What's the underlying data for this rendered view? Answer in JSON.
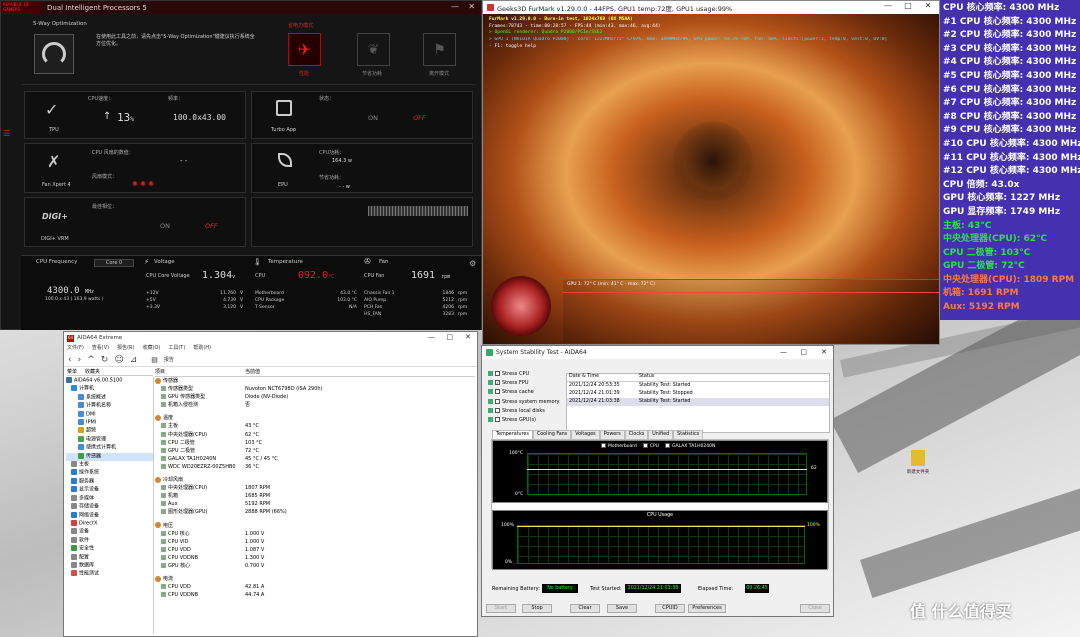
{
  "asus": {
    "title": "Dual Intelligent Processors 5",
    "five_way": "5-Way Optimization",
    "five_way_desc": "在使用此工具之前，请先点击\"5-Way Optimization\"键建议执行系统全方位优化。",
    "mode_title": "省电力模式",
    "modes": [
      "性能",
      "节省功耗",
      "离开模式"
    ],
    "tpu": {
      "label": "TPU",
      "speed_label": "CPU速度：",
      "speed_value": "13",
      "speed_unit": "%",
      "freq_label": "频率：",
      "freq_value": "100.0x43.00"
    },
    "turbo": {
      "label": "Turbo App",
      "status_label": "状态：",
      "on": "ON",
      "off": "OFF"
    },
    "fan": {
      "label": "Fan Xpert 4",
      "cpu_fan_label": "CPU 风扇的数值：",
      "cpu_fan_value": "- -",
      "mode_label": "风扇模式："
    },
    "epu": {
      "label": "EPU",
      "cpu_power_label": "CPU功耗：",
      "cpu_power_value": "164.3 w",
      "save_label": "节省功耗：",
      "save_value": "- - w"
    },
    "digi": {
      "label": "DIGI+ VRM",
      "desc": "最佳相位：",
      "on": "ON",
      "off": "OFF"
    },
    "cpu_freq": {
      "title": "CPU Frequency",
      "core": "Core 0",
      "value": "4300.0",
      "unit": "MHz",
      "sub": "100.0  x  43    ( 163.9 watts )"
    },
    "voltage": {
      "title": "Voltage",
      "core_label": "CPU Core Voltage",
      "core_value": "1.304",
      "unit": "v",
      "rows": [
        [
          "+12V",
          "11.760",
          "V"
        ],
        [
          "+5V",
          "4.739",
          "V"
        ],
        [
          "+3.3V",
          "3.120",
          "V"
        ]
      ]
    },
    "temperature": {
      "title": "Temperature",
      "cpu_label": "CPU",
      "cpu_value": "092.0",
      "unit": "°C",
      "rows": [
        [
          "Motherboard",
          "43.0 °C"
        ],
        [
          "CPU Package",
          "103.0 °C"
        ],
        [
          "T Sensor",
          "N/A"
        ]
      ]
    },
    "fanpanel": {
      "title": "Fan",
      "cpu_fan_label": "CPU Fan",
      "cpu_fan_value": "1691",
      "unit": "rpm",
      "rows": [
        [
          "Chassis Fan 1",
          "1846",
          "rpm"
        ],
        [
          "AIO Pump",
          "5212",
          "rpm"
        ],
        [
          "PCH Fan",
          "4206",
          "rpm"
        ],
        [
          "HS_FAN",
          "3283",
          "rpm"
        ]
      ]
    }
  },
  "furmark": {
    "title": "Geeks3D FurMark v1.29.0.0 - 44FPS, GPU1 temp:72度, GPU1 usage:99%",
    "info": [
      "FurMark v1.29.0.0 - Burn-in test, 1024x768 (0X MSAA)",
      "Frames:78743 - time:00:28:57 - FPS:44 (min:43, max:46, avg:44)",
      "> OpenGL renderer: Quadro P2000/PCIe/SSE2",
      "> GPU 1 (NVIDIA Quadro P2000) - core: 1227MHz/72° C/97%, mem: 3499MHz/9%, GPU power: 93.1% TDP, fan: 66%, limits:[power:1, temp:0, volt:0, OV:0]",
      "- F1: toggle help"
    ],
    "graph_label": "GPU 1: 72° C (min: 41° C - max: 72° C)"
  },
  "freq_list": [
    {
      "text": "CPU 核心频率: 4300 MHz",
      "color": "#ffffff"
    },
    {
      "text": "#1 CPU 核心频率: 4300 MHz",
      "color": "#ffffff"
    },
    {
      "text": "#2 CPU 核心频率: 4300 MHz",
      "color": "#ffffff"
    },
    {
      "text": "#3 CPU 核心频率: 4300 MHz",
      "color": "#ffffff"
    },
    {
      "text": "#4 CPU 核心频率: 4300 MHz",
      "color": "#ffffff"
    },
    {
      "text": "#5 CPU 核心频率: 4300 MHz",
      "color": "#ffffff"
    },
    {
      "text": "#6 CPU 核心频率: 4300 MHz",
      "color": "#ffffff"
    },
    {
      "text": "#7 CPU 核心频率: 4300 MHz",
      "color": "#ffffff"
    },
    {
      "text": "#8 CPU 核心频率: 4300 MHz",
      "color": "#ffffff"
    },
    {
      "text": "#9 CPU 核心频率: 4300 MHz",
      "color": "#ffffff"
    },
    {
      "text": "#10 CPU 核心频率: 4300 MHz",
      "color": "#ffffff"
    },
    {
      "text": "#11 CPU 核心频率: 4300 MHz",
      "color": "#ffffff"
    },
    {
      "text": "#12 CPU 核心频率: 4300 MHz",
      "color": "#ffffff"
    },
    {
      "text": "CPU 倍频: 43.0x",
      "color": "#ffffff"
    },
    {
      "text": "GPU 核心频率: 1227 MHz",
      "color": "#ffffff"
    },
    {
      "text": "GPU 显存频率: 1749 MHz",
      "color": "#ffffff"
    },
    {
      "text": "主板: 43°C",
      "color": "#2ee04a"
    },
    {
      "text": "中央处理器(CPU): 62°C",
      "color": "#2ee04a"
    },
    {
      "text": "CPU 二极管: 103°C",
      "color": "#2ee04a"
    },
    {
      "text": "GPU 二极管: 72°C",
      "color": "#2ee04a"
    },
    {
      "text": "中央处理器(CPU): 1809 RPM",
      "color": "#ff7a3a"
    },
    {
      "text": "机箱: 1691 RPM",
      "color": "#ff7a3a"
    },
    {
      "text": "Aux: 5192 RPM",
      "color": "#ff7a3a"
    }
  ],
  "aida": {
    "title": "AIDA64 Extreme",
    "menu": [
      "文件(F)",
      "查看(V)",
      "报告(R)",
      "收藏(O)",
      "工具(T)",
      "帮助(H)"
    ],
    "report_btn": "报告",
    "tab_menu": "菜单",
    "tab_fav": "收藏夹",
    "tree": [
      "AIDA64 v6.00.5100",
      "计算机",
      "系统概述",
      "计算机名称",
      "DMI",
      "IPMI",
      "超频",
      "电源管理",
      "便携式计算机",
      "传感器",
      "主板",
      "操作系统",
      "服务器",
      "显示设备",
      "多媒体",
      "存储设备",
      "网络设备",
      "DirectX",
      "设备",
      "软件",
      "安全性",
      "配置",
      "数据库",
      "性能测试"
    ],
    "col_item": "项目",
    "col_value": "当前值",
    "sections": [
      {
        "title": "传感器",
        "rows": [
          [
            "传感器类型",
            "Nuvoton NCT6798D (ISA 290h)"
          ],
          [
            "GPU 传感器类型",
            "Diode (NV-Diode)"
          ],
          [
            "机箱入侵检测",
            "否"
          ]
        ]
      },
      {
        "title": "温度",
        "rows": [
          [
            "主板",
            "43 °C"
          ],
          [
            "中央处理器(CPU)",
            "62 °C"
          ],
          [
            "CPU 二极管",
            "103 °C"
          ],
          [
            "GPU 二极管",
            "72 °C"
          ],
          [
            "GALAX TA1H0240N",
            "45 °C / 45 °C"
          ],
          [
            "WDC WD20EZRZ-00Z5HB0",
            "36 °C"
          ]
        ]
      },
      {
        "title": "冷却风扇",
        "rows": [
          [
            "中央处理器(CPU)",
            "1807 RPM"
          ],
          [
            "机箱",
            "1685 RPM"
          ],
          [
            "Aux",
            "5192 RPM"
          ],
          [
            "图形处理器(GPU)",
            "2888 RPM  (66%)"
          ]
        ]
      },
      {
        "title": "电压",
        "rows": [
          [
            "CPU 核心",
            "1.000 V"
          ],
          [
            "CPU VID",
            "1.000 V"
          ],
          [
            "CPU VDD",
            "1.087 V"
          ],
          [
            "CPU VDDNB",
            "1.300 V"
          ],
          [
            "GPU 核心",
            "0.700 V"
          ]
        ]
      },
      {
        "title": "电流",
        "rows": [
          [
            "CPU VDD",
            "42.81 A"
          ],
          [
            "CPU VDDNB",
            "44.74 A"
          ]
        ]
      }
    ]
  },
  "stability": {
    "title": "System Stability Test - AIDA64",
    "checks": [
      [
        "Stress CPU",
        false
      ],
      [
        "Stress FPU",
        true
      ],
      [
        "Stress cache",
        false
      ],
      [
        "Stress system memory",
        false
      ],
      [
        "Stress local disks",
        false
      ],
      [
        "Stress GPU(s)",
        false
      ]
    ],
    "log_headers": [
      "Date & Time",
      "Status"
    ],
    "log": [
      [
        "2021/12/24 20:53:35",
        "Stability Test: Started"
      ],
      [
        "2021/12/24 21:01:39",
        "Stability Test: Stopped"
      ],
      [
        "2021/12/24 21:03:38",
        "Stability Test: Started"
      ]
    ],
    "tabs": [
      "Temperatures",
      "Cooling Fans",
      "Voltages",
      "Powers",
      "Clocks",
      "Unified",
      "Statistics"
    ],
    "legend": [
      "Motherboard",
      "CPU",
      "GALAX TA1H0240N"
    ],
    "temp_top": "100°C",
    "temp_bot": "0°C",
    "temp_val": "62",
    "usage_title": "CPU Usage",
    "usage_top": "100%",
    "usage_bot": "0%",
    "usage_val": "100%",
    "battery_label": "Remaining Battery:",
    "battery_value": "No battery",
    "started_label": "Test Started:",
    "started_value": "2021/12/24 21:03:38",
    "elapsed_label": "Elapsed Time:",
    "elapsed_value": "00:26:45",
    "buttons": [
      "Start",
      "Stop",
      "Clear",
      "Save",
      "CPUID",
      "Preferences",
      "Close"
    ]
  },
  "desktop": {
    "folder_label": "新建文件夹",
    "watermark": "值 什么值得买"
  }
}
